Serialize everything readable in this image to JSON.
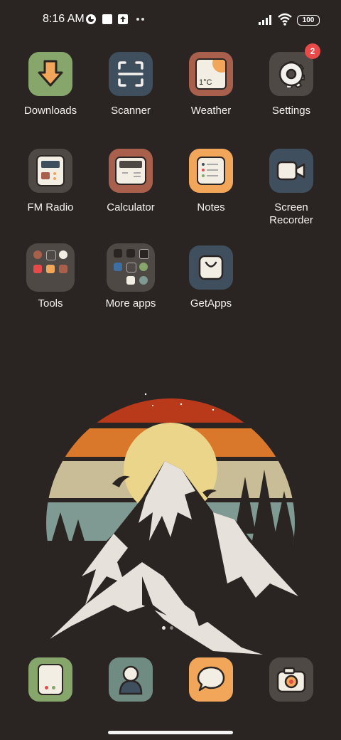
{
  "status_bar": {
    "time": "8:16 AM",
    "notification_icons": [
      "vpn-icon",
      "square-notification-icon",
      "upload-icon",
      "more-dots-icon"
    ],
    "signal_icon": "signal-bars-icon",
    "wifi_icon": "wifi-icon",
    "battery": "100"
  },
  "apps": [
    {
      "label": "Downloads",
      "icon": "download-arrow-icon",
      "bg": "#86a66b"
    },
    {
      "label": "Scanner",
      "icon": "scan-frame-icon",
      "bg": "#3f4f5e"
    },
    {
      "label": "Weather",
      "icon": "weather-card-icon",
      "bg": "#a8604c",
      "temp": "1°C"
    },
    {
      "label": "Settings",
      "icon": "gear-icon",
      "bg": "#4e4945",
      "badge": "2"
    },
    {
      "label": "FM Radio",
      "icon": "radio-icon",
      "bg": "#4e4945"
    },
    {
      "label": "Calculator",
      "icon": "calculator-icon",
      "bg": "#a8604c"
    },
    {
      "label": "Notes",
      "icon": "notes-list-icon",
      "bg": "#f2a65a"
    },
    {
      "label": "Screen Recorder",
      "icon": "video-camera-icon",
      "bg": "#3f4f5e"
    },
    {
      "label": "Tools",
      "icon": "folder-icon"
    },
    {
      "label": "More apps",
      "icon": "folder-icon"
    },
    {
      "label": "GetApps",
      "icon": "shopping-bag-icon",
      "bg": "#3f4f5e"
    }
  ],
  "dock": [
    {
      "icon": "phone-icon",
      "bg": "#86a66b"
    },
    {
      "icon": "contacts-icon",
      "bg": "#6f8b82"
    },
    {
      "icon": "messages-icon",
      "bg": "#f2a65a"
    },
    {
      "icon": "camera-icon",
      "bg": "#4e4945"
    }
  ],
  "wallpaper": "mountain-sunset-illustration",
  "colors": {
    "background": "#2a2522",
    "red_band": "#b83a1a",
    "orange_band": "#d9782a",
    "beige_band": "#c8bd96",
    "teal_band": "#7f9a92",
    "sun": "#ead58a",
    "badge": "#e84a4a"
  }
}
